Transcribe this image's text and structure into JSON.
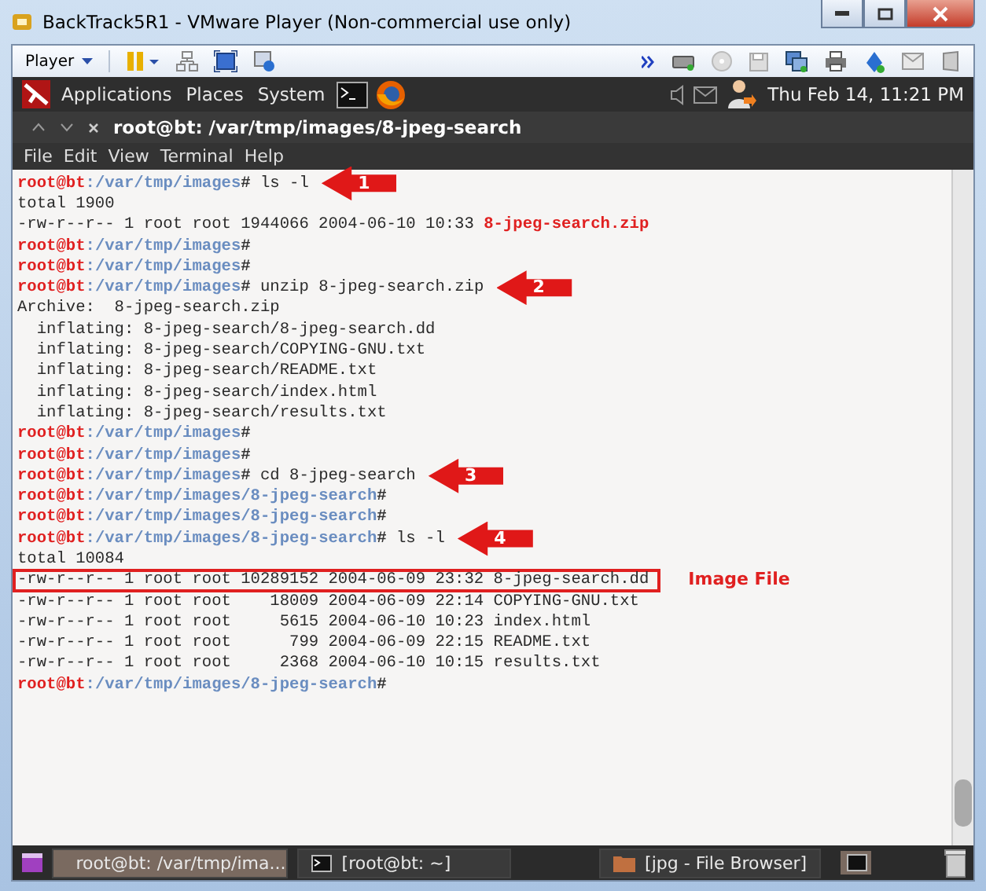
{
  "window": {
    "title": "BackTrack5R1 - VMware Player (Non-commercial use only)"
  },
  "toolbar": {
    "player_menu": "Player"
  },
  "panel": {
    "menus": [
      "Applications",
      "Places",
      "System"
    ],
    "clock": "Thu Feb 14, 11:21 PM"
  },
  "terminal": {
    "title": "root@bt: /var/tmp/images/8-jpeg-search",
    "menu": [
      "File",
      "Edit",
      "View",
      "Terminal",
      "Help"
    ],
    "lines": [
      {
        "kind": "prompt",
        "user": "root@bt",
        "path": ":/var/tmp/images",
        "symbol": "#",
        "command": "ls -l",
        "step": "1"
      },
      {
        "kind": "output",
        "text": "total 1900"
      },
      {
        "kind": "file",
        "text": "-rw-r--r-- 1 root root 1944066 2004-06-10 10:33",
        "name": "8-jpeg-search.zip",
        "archive": true,
        "highlighted": false
      },
      {
        "kind": "prompt",
        "user": "root@bt",
        "path": ":/var/tmp/images",
        "symbol": "#"
      },
      {
        "kind": "prompt",
        "user": "root@bt",
        "path": ":/var/tmp/images",
        "symbol": "#"
      },
      {
        "kind": "prompt",
        "user": "root@bt",
        "path": ":/var/tmp/images",
        "symbol": "#",
        "command": "unzip 8-jpeg-search.zip",
        "step": "2"
      },
      {
        "kind": "output",
        "text": "Archive:  8-jpeg-search.zip"
      },
      {
        "kind": "output",
        "text": "  inflating: 8-jpeg-search/8-jpeg-search.dd"
      },
      {
        "kind": "output",
        "text": "  inflating: 8-jpeg-search/COPYING-GNU.txt"
      },
      {
        "kind": "output",
        "text": "  inflating: 8-jpeg-search/README.txt"
      },
      {
        "kind": "output",
        "text": "  inflating: 8-jpeg-search/index.html"
      },
      {
        "kind": "output",
        "text": "  inflating: 8-jpeg-search/results.txt"
      },
      {
        "kind": "prompt",
        "user": "root@bt",
        "path": ":/var/tmp/images",
        "symbol": "#"
      },
      {
        "kind": "prompt",
        "user": "root@bt",
        "path": ":/var/tmp/images",
        "symbol": "#"
      },
      {
        "kind": "prompt",
        "user": "root@bt",
        "path": ":/var/tmp/images",
        "symbol": "#",
        "command": "cd 8-jpeg-search",
        "step": "3"
      },
      {
        "kind": "prompt",
        "user": "root@bt",
        "path": ":/var/tmp/images/8-jpeg-search",
        "symbol": "#"
      },
      {
        "kind": "prompt",
        "user": "root@bt",
        "path": ":/var/tmp/images/8-jpeg-search",
        "symbol": "#"
      },
      {
        "kind": "prompt",
        "user": "root@bt",
        "path": ":/var/tmp/images/8-jpeg-search",
        "symbol": "#",
        "command": "ls -l",
        "step": "4"
      },
      {
        "kind": "output",
        "text": "total 10084"
      },
      {
        "kind": "file",
        "text": "-rw-r--r-- 1 root root 10289152 2004-06-09 23:32",
        "name": "8-jpeg-search.dd",
        "archive": false,
        "highlighted": true,
        "note": "Image File"
      },
      {
        "kind": "file",
        "text": "-rw-r--r-- 1 root root    18009 2004-06-09 22:14",
        "name": "COPYING-GNU.txt",
        "archive": false,
        "highlighted": false
      },
      {
        "kind": "file",
        "text": "-rw-r--r-- 1 root root     5615 2004-06-10 10:23",
        "name": "index.html",
        "archive": false,
        "highlighted": false
      },
      {
        "kind": "file",
        "text": "-rw-r--r-- 1 root root      799 2004-06-09 22:15",
        "name": "README.txt",
        "archive": false,
        "highlighted": false
      },
      {
        "kind": "file",
        "text": "-rw-r--r-- 1 root root     2368 2004-06-10 10:15",
        "name": "results.txt",
        "archive": false,
        "highlighted": false
      },
      {
        "kind": "prompt",
        "user": "root@bt",
        "path": ":/var/tmp/images/8-jpeg-search",
        "symbol": "#"
      }
    ]
  },
  "taskbar": {
    "items": [
      {
        "label": "root@bt: /var/tmp/ima...",
        "kind": "terminal",
        "selected": true
      },
      {
        "label": "[root@bt: ~]",
        "kind": "terminal",
        "selected": false
      },
      {
        "label": "[jpg - File Browser]",
        "kind": "folder",
        "selected": false
      }
    ]
  }
}
